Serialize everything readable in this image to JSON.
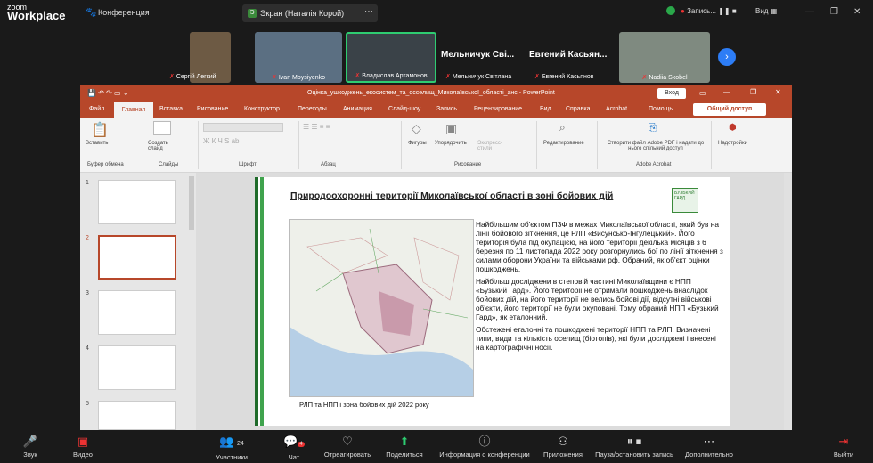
{
  "zoom": {
    "logo_line1": "zoom",
    "logo_line2": "Workplace",
    "conference": "Конференция",
    "screen_label": "Экран (Наталія Корой)",
    "record": "Запись...",
    "view": "Вид"
  },
  "participants": [
    {
      "name": "Сергій Легкий"
    },
    {
      "name": "Ivan Moysiyenko"
    },
    {
      "name": "Владислав Артамонов"
    },
    {
      "bigname": "Мельничук Сві...",
      "name": "Мельничук Світлана"
    },
    {
      "bigname": "Евгений Касьян...",
      "name": "Евгений Касьянов"
    },
    {
      "name": "Nadiia Skobel"
    }
  ],
  "ppt": {
    "title": "Оцінка_ушкоджень_екосистем_та_осселищ_Миколаївської_області_анс - PowerPoint",
    "signin": "Вход",
    "tabs": [
      "Файл",
      "Главная",
      "Вставка",
      "Рисование",
      "Конструктор",
      "Переходы",
      "Анимация",
      "Слайд-шоу",
      "Запись",
      "Рецензирование",
      "Вид",
      "Справка",
      "Acrobat",
      "Помощь"
    ],
    "share": "Общий доступ",
    "ribbon": {
      "paste": "Вставить",
      "clipboard": "Буфер обмена",
      "new_slide": "Создать слайд",
      "slides": "Слайды",
      "font": "Шрифт",
      "paragraph": "Абзац",
      "shapes": "Фигуры",
      "arrange": "Упорядочить",
      "express": "Экспресс-стили",
      "drawing": "Рисование",
      "editing": "Редактирование",
      "adobe_create": "Створити файл Adobe PDF і надати до нього спільний доступ",
      "adobe": "Adobe Acrobat",
      "addins": "Надстройки"
    },
    "thumbs": [
      "1",
      "2",
      "3",
      "4",
      "5"
    ],
    "slide": {
      "title": "Природоохоронні території Миколаївської області в зоні бойових дій",
      "logo_text": "БУЗЬКИЙ ГАРД",
      "p1": "Найбільшим об'єктом ПЗФ в межах Миколаївської області, який був на лінії бойового зіткнення, це РЛП «Висунсько-Інгулецький». Його територія була під окупацією, на його території декілька місяців з 6 березня по 11 листопада 2022 року розгорнулись бої по лінії зіткнення з силами оборони України та військами рф. Обраний, як об'єкт оцінки пошкоджень.",
      "p2": "Найбільш досліджени в степовій частині Миколаївщини є  НПП «Бузький Гард». Його території не отримали пошкоджень внаслідок бойових дій, на його території не велись бойові дії, відсутні військові об'єкти, його території не були окуповані. Тому обраний НПП «Бузький Гард», як еталонний.",
      "p3": "Обстежені еталонні та пошкоджені території НПП та РЛП. Визначені типи, види та кількість оселищ (біотопів), які були досліджені і внесені на картографічні носії.",
      "caption": "РЛП та НПП і зона бойових дій 2022 року"
    }
  },
  "toolbar": [
    {
      "label": "Звук",
      "icon": "mic-muted-icon"
    },
    {
      "label": "Видео",
      "icon": "video-off-icon"
    },
    {
      "label": "Участники",
      "icon": "participants-icon",
      "count": "24"
    },
    {
      "label": "Чат",
      "icon": "chat-icon",
      "badge": "4"
    },
    {
      "label": "Отреагировать",
      "icon": "heart-icon"
    },
    {
      "label": "Поделиться",
      "icon": "share-icon"
    },
    {
      "label": "Информация о конференции",
      "icon": "info-icon"
    },
    {
      "label": "Приложения",
      "icon": "apps-icon"
    },
    {
      "label": "Пауза/остановить запись",
      "icon": "pause-stop-icon"
    },
    {
      "label": "Дополнительно",
      "icon": "more-icon"
    },
    {
      "label": "Выйти",
      "icon": "leave-icon"
    }
  ],
  "colors": {
    "ppt_accent": "#b7472a",
    "zoom_bg": "#1a1a1a",
    "slide_green": "#2e7d32"
  }
}
